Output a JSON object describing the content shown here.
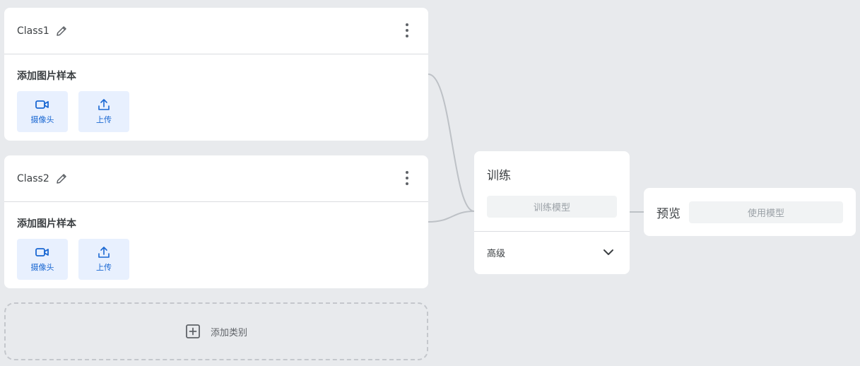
{
  "classes": [
    {
      "name": "Class1",
      "samples_title": "添加图片样本",
      "webcam_label": "摄像头",
      "upload_label": "上传"
    },
    {
      "name": "Class2",
      "samples_title": "添加图片样本",
      "webcam_label": "摄像头",
      "upload_label": "上传"
    }
  ],
  "add_class_label": "添加类别",
  "training": {
    "title": "训练",
    "train_button_label": "训练模型",
    "advanced_label": "高级"
  },
  "preview": {
    "title": "预览",
    "use_model_label": "使用模型"
  },
  "colors": {
    "accent_blue": "#1967d2",
    "sample_button_bg": "#e8f0fe",
    "background": "#e8eaed",
    "disabled_text": "#9aa0a6"
  },
  "icons": {
    "edit": "pencil-icon",
    "more": "more-vertical-icon",
    "webcam": "video-camera-icon",
    "upload": "upload-icon",
    "add": "plus-square-icon",
    "expand": "chevron-down-icon"
  }
}
